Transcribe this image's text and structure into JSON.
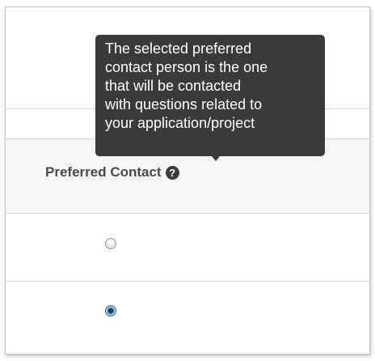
{
  "tooltip": {
    "lines": [
      "The selected preferred",
      "contact person is the one",
      "that will be contacted",
      "with questions related to",
      "your application/project"
    ]
  },
  "table": {
    "header_label": "Preferred Contact",
    "help_icon": "question-circle-icon",
    "help_glyph": "?",
    "rows": [
      {
        "selected": false
      },
      {
        "selected": true
      }
    ]
  }
}
